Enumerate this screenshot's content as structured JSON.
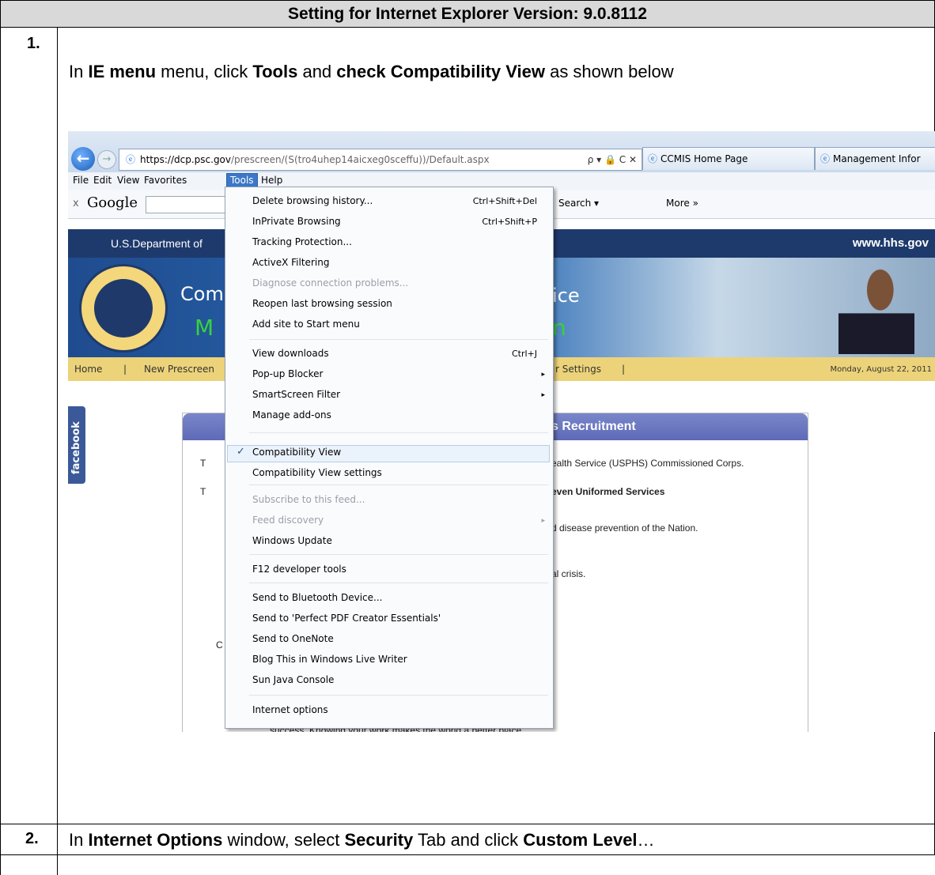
{
  "doc": {
    "header": "Setting for Internet Explorer Version: 9.0.8112",
    "step1": {
      "num": "1.",
      "prefix": "In ",
      "b1": "IE menu",
      "mid1": " menu, click  ",
      "b2": "Tools",
      "mid2": " and ",
      "b3": "check Compatibility View",
      "suffix": " as shown below"
    },
    "step2": {
      "num": "2.",
      "prefix": "In ",
      "b1": "Internet Options",
      "mid1": " window, select ",
      "b2": "Security",
      "mid2": " Tab and click ",
      "b3": "Custom Level",
      "suffix": "…"
    }
  },
  "browser": {
    "address_host": "https://dcp.psc.gov",
    "address_path": "/prescreen/(S(tro4uhep14aicxeg0sceffu))/Default.aspx",
    "address_controls": "ρ ▾ 🔒 C ✕",
    "tabs": [
      "CCMIS Home Page",
      "Management Infor"
    ],
    "menubar": [
      "File",
      "Edit",
      "View",
      "Favorites",
      "Tools",
      "Help"
    ],
    "google": {
      "close": "x",
      "logo": "Google",
      "search": "Search ▾",
      "more": "More »"
    }
  },
  "site": {
    "dept": "U.S.Department of",
    "hhs": "www.hhs.gov",
    "banner_left1": "Comr",
    "banner_left2": "M",
    "banner_right1": "ice",
    "banner_right2": "n",
    "nav": [
      "Home",
      "|",
      "New Prescreen",
      "r Settings",
      "|"
    ],
    "date": "Monday, August 22, 2011",
    "facebook": "facebook",
    "panel_title": "s Recruitment",
    "panel_lines": [
      "ealth Service (USPHS) Commissioned Corps.",
      "even Uniformed Services",
      "d disease prevention of the Nation.",
      "al crisis."
    ],
    "panel_letters": [
      "T",
      "T",
      "C"
    ],
    "bottom_text": "success. Knowing your work makes the world a better place."
  },
  "tools_menu": {
    "items": [
      {
        "label": "Delete browsing history...",
        "shortcut": "Ctrl+Shift+Del"
      },
      {
        "label": "InPrivate Browsing",
        "shortcut": "Ctrl+Shift+P"
      },
      {
        "label": "Tracking Protection..."
      },
      {
        "label": "ActiveX Filtering"
      },
      {
        "label": "Diagnose connection problems...",
        "disabled": true
      },
      {
        "label": "Reopen last browsing session"
      },
      {
        "label": "Add site to Start menu"
      },
      {
        "label": "View downloads",
        "shortcut": "Ctrl+J"
      },
      {
        "label": "Pop-up Blocker",
        "submenu": true
      },
      {
        "label": "SmartScreen Filter",
        "submenu": true
      },
      {
        "label": "Manage add-ons"
      },
      {
        "label": "Compatibility View",
        "checked": true
      },
      {
        "label": "Compatibility View settings"
      },
      {
        "label": "Subscribe to this feed...",
        "disabled": true
      },
      {
        "label": "Feed discovery",
        "disabled": true,
        "submenu": true
      },
      {
        "label": "Windows Update"
      },
      {
        "label": "F12 developer tools"
      },
      {
        "label": "Send to Bluetooth Device..."
      },
      {
        "label": "Send to 'Perfect PDF Creator Essentials'"
      },
      {
        "label": "Send to OneNote"
      },
      {
        "label": "Blog This in Windows Live Writer"
      },
      {
        "label": "Sun Java Console"
      },
      {
        "label": "Internet options"
      }
    ],
    "check_glyph": "✓",
    "submenu_glyph": "▸"
  }
}
